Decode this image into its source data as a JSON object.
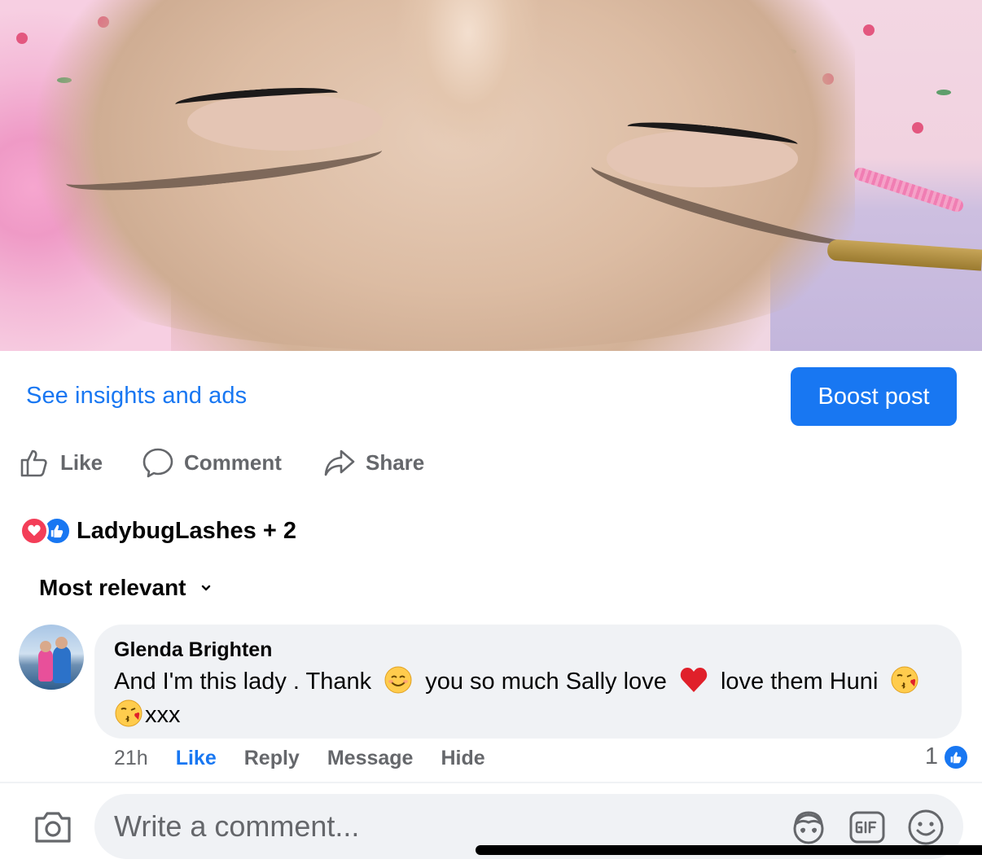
{
  "post": {
    "image_alt": "Close-up of client with lash extensions"
  },
  "insights": {
    "link_label": "See insights and ads",
    "boost_label": "Boost post"
  },
  "actions": {
    "like": "Like",
    "comment": "Comment",
    "share": "Share"
  },
  "reactions": {
    "summary": "LadybugLashes + 2",
    "types": [
      "love",
      "like"
    ]
  },
  "sort": {
    "label": "Most relevant"
  },
  "comment": {
    "author": "Glenda Brighten",
    "text_parts": [
      "And I'm this lady . Thank",
      "you so much Sally love",
      "love them Huni",
      "xxx"
    ],
    "emojis": [
      "smiling-face-icon",
      "red-heart-icon",
      "face-blowing-kiss-icon",
      "face-blowing-kiss-icon"
    ],
    "time": "21h",
    "like_label": "Like",
    "reply_label": "Reply",
    "message_label": "Message",
    "hide_label": "Hide",
    "like_count": "1"
  },
  "composer": {
    "placeholder": "Write a comment..."
  },
  "colors": {
    "accent": "#1877f2",
    "secondary_text": "#65676b",
    "bubble": "#f0f2f5",
    "love": "#f33e58"
  }
}
